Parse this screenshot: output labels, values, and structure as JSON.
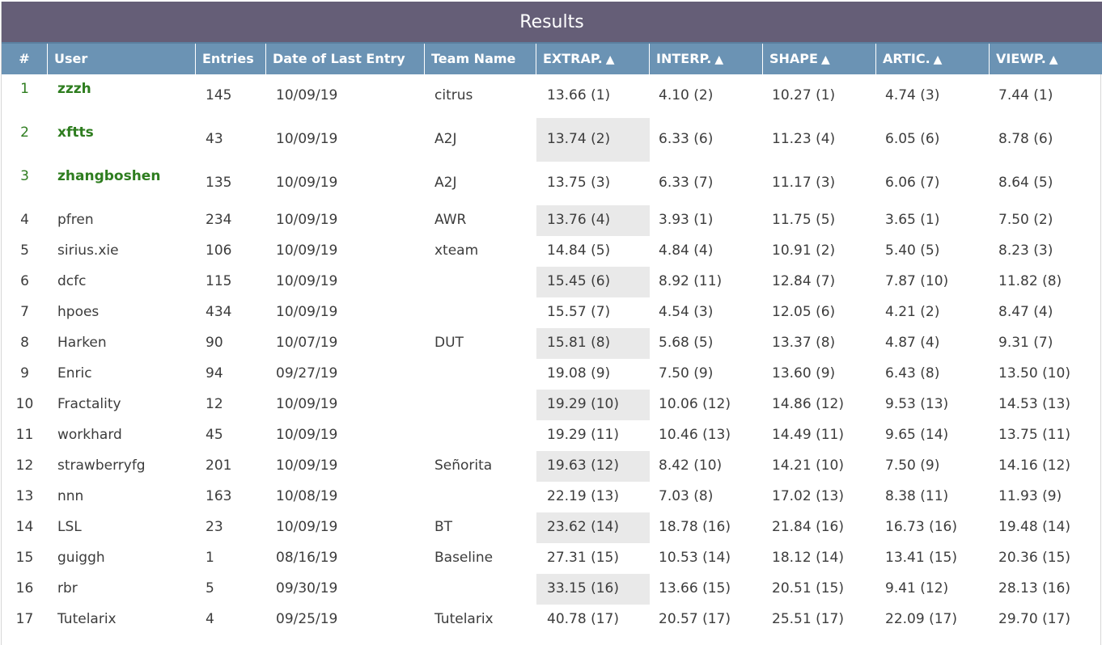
{
  "title": "Results",
  "columns": {
    "rank": "#",
    "user": "User",
    "entries": "Entries",
    "date": "Date of Last Entry",
    "team": "Team Name",
    "extrap": "EXTRAP.",
    "interp": "INTERP.",
    "shape": "SHAPE",
    "artic": "ARTIC.",
    "viewp": "VIEWP."
  },
  "sort_icon": "triangle-up-icon",
  "colors": {
    "title_bar": "#655e77",
    "header_bar": "#6b93b4",
    "top_user": "#2e7d1f",
    "highlight": "#e9e9e9"
  },
  "rows": [
    {
      "rank": "1",
      "user": "zzzh",
      "entries": "145",
      "date": "10/09/19",
      "team": "citrus",
      "extrap": "13.66 (1)",
      "interp": "4.10 (2)",
      "shape": "10.27 (1)",
      "artic": "4.74 (3)",
      "viewp": "7.44 (1)"
    },
    {
      "rank": "2",
      "user": "xftts",
      "entries": "43",
      "date": "10/09/19",
      "team": "A2J",
      "extrap": "13.74 (2)",
      "interp": "6.33 (6)",
      "shape": "11.23 (4)",
      "artic": "6.05 (6)",
      "viewp": "8.78 (6)"
    },
    {
      "rank": "3",
      "user": "zhangboshen",
      "entries": "135",
      "date": "10/09/19",
      "team": "A2J",
      "extrap": "13.75 (3)",
      "interp": "6.33 (7)",
      "shape": "11.17 (3)",
      "artic": "6.06 (7)",
      "viewp": "8.64 (5)"
    },
    {
      "rank": "4",
      "user": "pfren",
      "entries": "234",
      "date": "10/09/19",
      "team": "AWR",
      "extrap": "13.76 (4)",
      "interp": "3.93 (1)",
      "shape": "11.75 (5)",
      "artic": "3.65 (1)",
      "viewp": "7.50 (2)"
    },
    {
      "rank": "5",
      "user": "sirius.xie",
      "entries": "106",
      "date": "10/09/19",
      "team": "xteam",
      "extrap": "14.84 (5)",
      "interp": "4.84 (4)",
      "shape": "10.91 (2)",
      "artic": "5.40 (5)",
      "viewp": "8.23 (3)"
    },
    {
      "rank": "6",
      "user": "dcfc",
      "entries": "115",
      "date": "10/09/19",
      "team": "",
      "extrap": "15.45 (6)",
      "interp": "8.92 (11)",
      "shape": "12.84 (7)",
      "artic": "7.87 (10)",
      "viewp": "11.82 (8)"
    },
    {
      "rank": "7",
      "user": "hpoes",
      "entries": "434",
      "date": "10/09/19",
      "team": "",
      "extrap": "15.57 (7)",
      "interp": "4.54 (3)",
      "shape": "12.05 (6)",
      "artic": "4.21 (2)",
      "viewp": "8.47 (4)"
    },
    {
      "rank": "8",
      "user": "Harken",
      "entries": "90",
      "date": "10/07/19",
      "team": "DUT",
      "extrap": "15.81 (8)",
      "interp": "5.68 (5)",
      "shape": "13.37 (8)",
      "artic": "4.87 (4)",
      "viewp": "9.31 (7)"
    },
    {
      "rank": "9",
      "user": "Enric",
      "entries": "94",
      "date": "09/27/19",
      "team": "",
      "extrap": "19.08 (9)",
      "interp": "7.50 (9)",
      "shape": "13.60 (9)",
      "artic": "6.43 (8)",
      "viewp": "13.50 (10)"
    },
    {
      "rank": "10",
      "user": "Fractality",
      "entries": "12",
      "date": "10/09/19",
      "team": "",
      "extrap": "19.29 (10)",
      "interp": "10.06 (12)",
      "shape": "14.86 (12)",
      "artic": "9.53 (13)",
      "viewp": "14.53 (13)"
    },
    {
      "rank": "11",
      "user": "workhard",
      "entries": "45",
      "date": "10/09/19",
      "team": "",
      "extrap": "19.29 (11)",
      "interp": "10.46 (13)",
      "shape": "14.49 (11)",
      "artic": "9.65 (14)",
      "viewp": "13.75 (11)"
    },
    {
      "rank": "12",
      "user": "strawberryfg",
      "entries": "201",
      "date": "10/09/19",
      "team": "Señorita",
      "extrap": "19.63 (12)",
      "interp": "8.42 (10)",
      "shape": "14.21 (10)",
      "artic": "7.50 (9)",
      "viewp": "14.16 (12)"
    },
    {
      "rank": "13",
      "user": "nnn",
      "entries": "163",
      "date": "10/08/19",
      "team": "",
      "extrap": "22.19 (13)",
      "interp": "7.03 (8)",
      "shape": "17.02 (13)",
      "artic": "8.38 (11)",
      "viewp": "11.93 (9)"
    },
    {
      "rank": "14",
      "user": "LSL",
      "entries": "23",
      "date": "10/09/19",
      "team": "BT",
      "extrap": "23.62 (14)",
      "interp": "18.78 (16)",
      "shape": "21.84 (16)",
      "artic": "16.73 (16)",
      "viewp": "19.48 (14)"
    },
    {
      "rank": "15",
      "user": "guiggh",
      "entries": "1",
      "date": "08/16/19",
      "team": "Baseline",
      "extrap": "27.31 (15)",
      "interp": "10.53 (14)",
      "shape": "18.12 (14)",
      "artic": "13.41 (15)",
      "viewp": "20.36 (15)"
    },
    {
      "rank": "16",
      "user": "rbr",
      "entries": "5",
      "date": "09/30/19",
      "team": "",
      "extrap": "33.15 (16)",
      "interp": "13.66 (15)",
      "shape": "20.51 (15)",
      "artic": "9.41 (12)",
      "viewp": "28.13 (16)"
    },
    {
      "rank": "17",
      "user": "Tutelarix",
      "entries": "4",
      "date": "09/25/19",
      "team": "Tutelarix",
      "extrap": "40.78 (17)",
      "interp": "20.57 (17)",
      "shape": "25.51 (17)",
      "artic": "22.09 (17)",
      "viewp": "29.70 (17)"
    }
  ]
}
